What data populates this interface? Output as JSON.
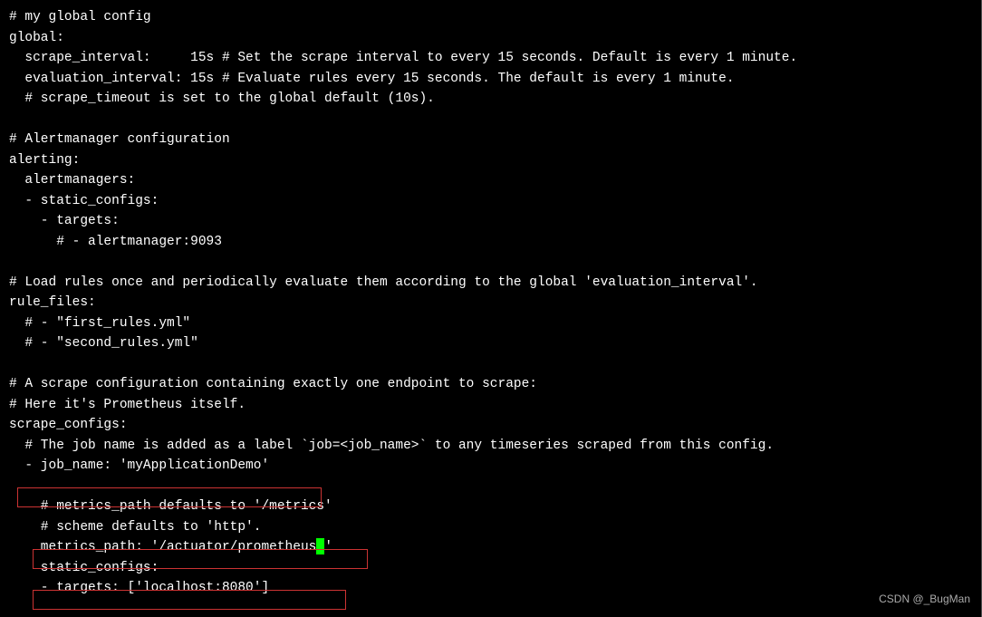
{
  "lines": {
    "l01": "# my global config",
    "l02": "global:",
    "l03": "  scrape_interval:     15s # Set the scrape interval to every 15 seconds. Default is every 1 minute.",
    "l04": "  evaluation_interval: 15s # Evaluate rules every 15 seconds. The default is every 1 minute.",
    "l05": "  # scrape_timeout is set to the global default (10s).",
    "l06": "",
    "l07": "# Alertmanager configuration",
    "l08": "alerting:",
    "l09": "  alertmanagers:",
    "l10": "  - static_configs:",
    "l11": "    - targets:",
    "l12": "      # - alertmanager:9093",
    "l13": "",
    "l14": "# Load rules once and periodically evaluate them according to the global 'evaluation_interval'.",
    "l15": "rule_files:",
    "l16": "  # - \"first_rules.yml\"",
    "l17": "  # - \"second_rules.yml\"",
    "l18": "",
    "l19": "# A scrape configuration containing exactly one endpoint to scrape:",
    "l20": "# Here it's Prometheus itself.",
    "l21": "scrape_configs:",
    "l22": "  # The job name is added as a label `job=<job_name>` to any timeseries scraped from this config.",
    "l23": "  - job_name: 'myApplicationDemo'",
    "l24": "",
    "l25": "    # metrics_path defaults to '/metrics'",
    "l26": "    # scheme defaults to 'http'.",
    "l27_pre": "    metrics_path: '/actuator/prometheus",
    "l27_post": "'",
    "l28": "    static_configs:",
    "l29": "    - targets: ['localhost:8080']"
  },
  "watermark": "CSDN @_BugMan"
}
